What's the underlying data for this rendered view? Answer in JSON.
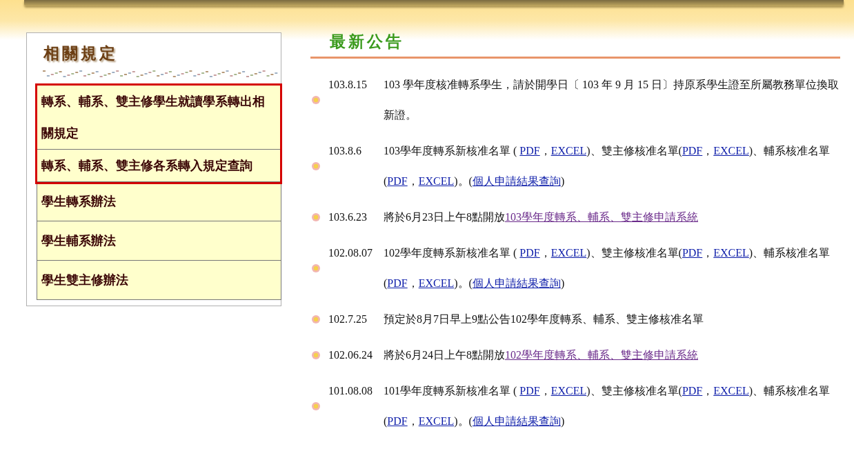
{
  "sidebar": {
    "title": "相關規定",
    "items": [
      {
        "label": "轉系、輔系、雙主修學生就讀學系轉出相關規定",
        "highlighted": true
      },
      {
        "label": "轉系、輔系、雙主修各系轉入規定查詢",
        "highlighted": true
      },
      {
        "label": "學生轉系辦法",
        "highlighted": false
      },
      {
        "label": "學生輔系辦法",
        "highlighted": false
      },
      {
        "label": "學生雙主修辦法",
        "highlighted": false
      }
    ]
  },
  "news": {
    "title": "最新公告",
    "items": [
      {
        "date": "103.8.15",
        "parts": [
          {
            "kind": "text",
            "text": "103 學年度核准轉系學生，請於開學日〔 103 年 9 月 15 日〕持原系學生證至所屬教務單位換取新證。"
          }
        ]
      },
      {
        "date": "103.8.6",
        "parts": [
          {
            "kind": "text",
            "text": "103學年度轉系新核准名單 ( "
          },
          {
            "kind": "link",
            "text": "PDF",
            "visited": false
          },
          {
            "kind": "text",
            "text": "，"
          },
          {
            "kind": "link",
            "text": "EXCEL",
            "visited": false
          },
          {
            "kind": "text",
            "text": ")、雙主修核准名單("
          },
          {
            "kind": "link",
            "text": "PDF",
            "visited": false
          },
          {
            "kind": "text",
            "text": "，"
          },
          {
            "kind": "link",
            "text": "EXCEL",
            "visited": false
          },
          {
            "kind": "text",
            "text": ")、輔系核准名單("
          },
          {
            "kind": "link",
            "text": "PDF",
            "visited": false
          },
          {
            "kind": "text",
            "text": "，"
          },
          {
            "kind": "link",
            "text": "EXCEL",
            "visited": false
          },
          {
            "kind": "text",
            "text": ")。("
          },
          {
            "kind": "link",
            "text": "個人申請結果查詢",
            "visited": false
          },
          {
            "kind": "text",
            "text": ")"
          }
        ]
      },
      {
        "date": "103.6.23",
        "parts": [
          {
            "kind": "text",
            "text": "將於6月23日上午8點開放"
          },
          {
            "kind": "link",
            "text": "103學年度轉系、輔系、雙主修申請系統",
            "visited": true
          }
        ]
      },
      {
        "date": "102.08.07",
        "parts": [
          {
            "kind": "text",
            "text": "102學年度轉系新核准名單 ( "
          },
          {
            "kind": "link",
            "text": "PDF",
            "visited": false
          },
          {
            "kind": "text",
            "text": "，"
          },
          {
            "kind": "link",
            "text": "EXCEL",
            "visited": false
          },
          {
            "kind": "text",
            "text": ")、雙主修核准名單("
          },
          {
            "kind": "link",
            "text": "PDF",
            "visited": false
          },
          {
            "kind": "text",
            "text": "，"
          },
          {
            "kind": "link",
            "text": "EXCEL",
            "visited": false
          },
          {
            "kind": "text",
            "text": ")、輔系核准名單("
          },
          {
            "kind": "link",
            "text": "PDF",
            "visited": false
          },
          {
            "kind": "text",
            "text": "，"
          },
          {
            "kind": "link",
            "text": "EXCEL",
            "visited": false
          },
          {
            "kind": "text",
            "text": ")。("
          },
          {
            "kind": "link",
            "text": "個人申請結果查詢",
            "visited": false
          },
          {
            "kind": "text",
            "text": ")"
          }
        ]
      },
      {
        "date": "102.7.25",
        "parts": [
          {
            "kind": "text",
            "text": "預定於8月7日早上9點公告102學年度轉系、輔系、雙主修核准名單"
          }
        ]
      },
      {
        "date": "102.06.24",
        "parts": [
          {
            "kind": "text",
            "text": "將於6月24日上午8點開放"
          },
          {
            "kind": "link",
            "text": "102學年度轉系、輔系、雙主修申請系統",
            "visited": true
          }
        ]
      },
      {
        "date": "101.08.08",
        "parts": [
          {
            "kind": "text",
            "text": "101學年度轉系新核准名單 ( "
          },
          {
            "kind": "link",
            "text": "PDF",
            "visited": false
          },
          {
            "kind": "text",
            "text": "，"
          },
          {
            "kind": "link",
            "text": "EXCEL",
            "visited": false
          },
          {
            "kind": "text",
            "text": ")、雙主修核准名單("
          },
          {
            "kind": "link",
            "text": "PDF",
            "visited": false
          },
          {
            "kind": "text",
            "text": "，"
          },
          {
            "kind": "link",
            "text": "EXCEL",
            "visited": false
          },
          {
            "kind": "text",
            "text": ")、輔系核准名單("
          },
          {
            "kind": "link",
            "text": "PDF",
            "visited": false
          },
          {
            "kind": "text",
            "text": "，"
          },
          {
            "kind": "link",
            "text": "EXCEL",
            "visited": false
          },
          {
            "kind": "text",
            "text": ")。("
          },
          {
            "kind": "link",
            "text": "個人申請結果查詢",
            "visited": false
          },
          {
            "kind": "text",
            "text": ")"
          }
        ]
      }
    ]
  }
}
